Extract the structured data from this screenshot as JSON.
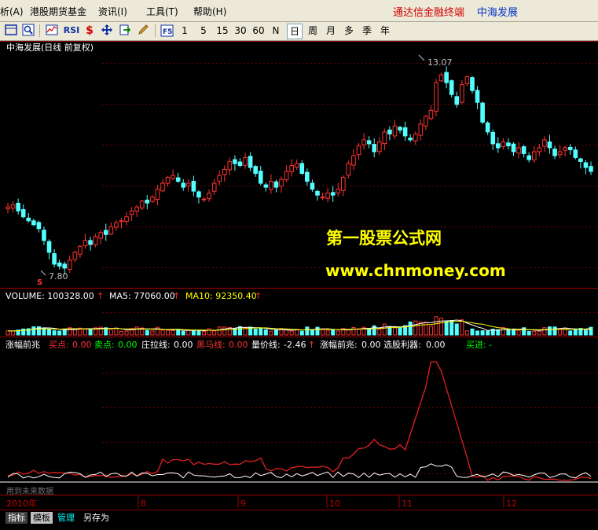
{
  "menubar": {
    "items": [
      "析(A)",
      "港股期货基金",
      "资讯(I)",
      "工具(T)",
      "帮助(H)"
    ],
    "brand": "通达信金融终端",
    "stock_name": "中海发展"
  },
  "toolbar": {
    "icons": [
      "layout-icon",
      "zoom-icon",
      "line-chart-icon",
      "rsi-icon",
      "dollar-icon",
      "move-icon",
      "export-icon",
      "pencil-icon"
    ],
    "rsi_label": "RSI",
    "dollar_label": "$",
    "f5_label": "F5",
    "periods": [
      "1",
      "5",
      "15",
      "30",
      "60",
      "N",
      "日",
      "周",
      "月",
      "多",
      "季",
      "年"
    ],
    "active_period": "日"
  },
  "main_chart": {
    "title": "中海发展(日线 前复权)",
    "high_label": "13.07",
    "low_label": "7.80",
    "s_marker": "S",
    "watermark_cn": "第一股票公式网",
    "watermark_url": "www.chnmoney.com"
  },
  "volume_panel": {
    "volume_label": "VOLUME: 100328.00",
    "ma5_label": "MA5: 77060.00",
    "ma10_label": "MA10: 92350.40",
    "arrow": "↑"
  },
  "indicator_panel": {
    "name": "涨幅前兆",
    "buy_label": "买点:",
    "buy_value": "0.00",
    "sell_label": "卖点:",
    "sell_value": "0.00",
    "zhuang_label": "庄拉线:",
    "zhuang_value": "0.00",
    "heima_label": "黑马线:",
    "heima_value": "0.00",
    "liangjia_label": "量价线:",
    "liangjia_value": "-2.46",
    "name2_label": "涨幅前兆:",
    "name2_value": "0.00",
    "xuangu_label": "选股利器:",
    "xuangu_value": "0.00",
    "maijin_label": "买进:",
    "maijin_value": "-",
    "future_data_note": "用到未来数据"
  },
  "time_axis": {
    "labels": [
      "2010年",
      "8",
      "9",
      "10",
      "11",
      "12"
    ]
  },
  "bottom_tabs": [
    "指标",
    "模板",
    "管理",
    "另存为"
  ],
  "colors": {
    "up": "#ff3232",
    "down": "#54ffff",
    "axis_red": "#a00000",
    "watermark": "#ffff00",
    "ma5": "#ffffff",
    "ma10": "#ffff00"
  },
  "chart_data": {
    "type": "candlestick",
    "price_range": [
      7.6,
      13.3
    ],
    "closes": [
      9.45,
      9.5,
      9.35,
      9.2,
      9.1,
      9.0,
      8.9,
      8.6,
      8.3,
      8.0,
      7.95,
      7.9,
      8.1,
      8.3,
      8.45,
      8.6,
      8.5,
      8.7,
      8.8,
      8.75,
      8.95,
      9.05,
      9.1,
      9.2,
      9.35,
      9.45,
      9.6,
      9.55,
      9.7,
      9.9,
      10.05,
      10.2,
      10.25,
      10.1,
      9.95,
      10.05,
      9.85,
      9.7,
      9.65,
      9.8,
      10.05,
      10.25,
      10.4,
      10.6,
      10.55,
      10.5,
      10.7,
      10.45,
      10.3,
      10.05,
      9.95,
      10.1,
      9.95,
      10.15,
      10.35,
      10.5,
      10.55,
      10.3,
      10.1,
      9.9,
      9.75,
      9.7,
      9.8,
      9.75,
      9.9,
      10.2,
      10.55,
      10.75,
      11.0,
      11.15,
      11.05,
      10.85,
      11.1,
      11.35,
      11.3,
      11.5,
      11.4,
      11.25,
      11.15,
      11.3,
      11.55,
      11.75,
      11.9,
      12.6,
      12.8,
      12.6,
      12.3,
      12.05,
      12.55,
      12.75,
      12.4,
      12.1,
      11.6,
      11.35,
      11.05,
      10.95,
      11.1,
      11.0,
      10.85,
      10.95,
      10.8,
      10.65,
      10.85,
      10.95,
      11.15,
      10.95,
      10.75,
      10.85,
      10.95,
      10.9,
      10.7,
      10.6,
      10.45,
      10.35
    ],
    "volume_ma5_now": 77060.0,
    "volume_ma10_now": 92350.4
  }
}
